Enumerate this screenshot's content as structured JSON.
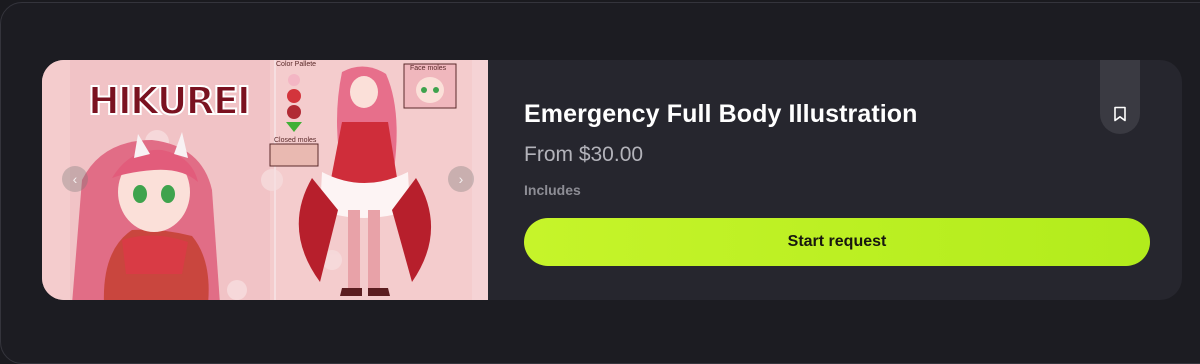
{
  "listing": {
    "artwork": {
      "logo_text": "HIKUREI",
      "labels": [
        "Color Pallete",
        "Face moles",
        "Closed moles"
      ]
    },
    "title": "Emergency Full Body Illustration",
    "price": "From $30.00",
    "includes_label": "Includes",
    "start_button_label": "Start request"
  },
  "icons": {
    "save": "bookmark-icon",
    "prev": "chevron-left-icon",
    "next": "chevron-right-icon"
  },
  "colors": {
    "accent": "#bdf124",
    "card": "#26262e",
    "background": "#1a1a1f"
  }
}
